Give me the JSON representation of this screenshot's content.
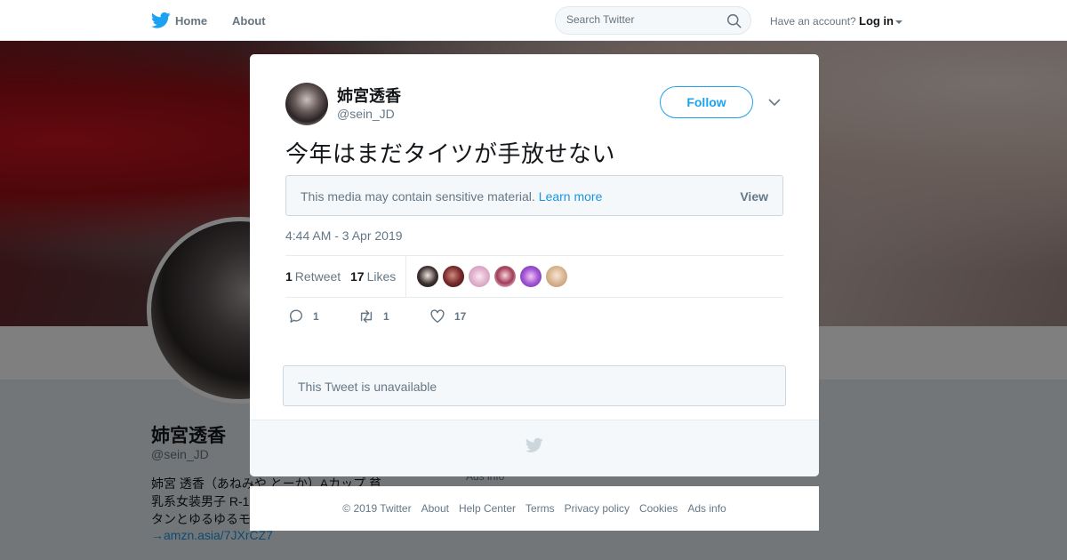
{
  "nav": {
    "home": "Home",
    "about": "About",
    "search_placeholder": "Search Twitter",
    "have_account": "Have an account?",
    "login": "Log in"
  },
  "profile": {
    "name": "姉宮透香",
    "handle": "@sein_JD",
    "bio": "姉宮 透香（あねみや とーか）Aカップ 貧\n乳系女装男子 R-1\nタンとゆるゆるモ",
    "bio_link": "→amzn.asia/7JXrCZ7",
    "ads_info": "Ads info"
  },
  "tweet": {
    "author_name": "姉宮透香",
    "author_handle": "@sein_JD",
    "follow_label": "Follow",
    "text": "今年はまだタイツが手放せない",
    "sensitive_notice": "This media may contain sensitive material.",
    "learn_more": "Learn more",
    "view_label": "View",
    "timestamp": "4:44 AM - 3 Apr 2019",
    "retweet_count": "1",
    "retweet_label": "Retweet",
    "likes_count": "17",
    "likes_label": "Likes",
    "reply_action_count": "1",
    "retweet_action_count": "1",
    "like_action_count": "17",
    "unavailable": "This Tweet is unavailable"
  },
  "footer": {
    "links": [
      "© 2019 Twitter",
      "About",
      "Help Center",
      "Terms",
      "Privacy policy",
      "Cookies",
      "Ads info"
    ]
  },
  "colors": {
    "accent": "#1da1f2",
    "link": "#1b95e0",
    "secondary_text": "#657786"
  }
}
